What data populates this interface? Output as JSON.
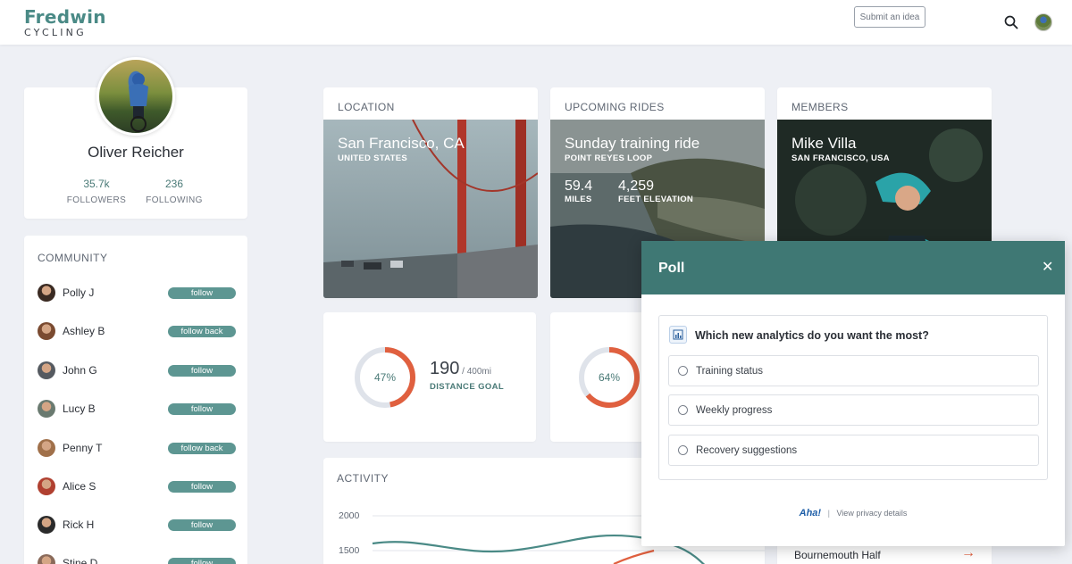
{
  "header": {
    "logo_top": "Fredwin",
    "logo_bottom": "CYCLING",
    "submit_label": "Submit an idea"
  },
  "profile": {
    "name": "Oliver Reicher",
    "followers_count": "35.7k",
    "followers_label": "FOLLOWERS",
    "following_count": "236",
    "following_label": "FOLLOWING"
  },
  "community": {
    "title": "COMMUNITY",
    "members": [
      {
        "name": "Polly J",
        "action": "follow",
        "color": "#3a2a22"
      },
      {
        "name": "Ashley B",
        "action": "follow back",
        "color": "#7a4a30"
      },
      {
        "name": "John G",
        "action": "follow",
        "color": "#555a60"
      },
      {
        "name": "Lucy B",
        "action": "follow",
        "color": "#6a7a70"
      },
      {
        "name": "Penny T",
        "action": "follow back",
        "color": "#a0704a"
      },
      {
        "name": "Alice S",
        "action": "follow",
        "color": "#b04030"
      },
      {
        "name": "Rick H",
        "action": "follow",
        "color": "#2a2a2a"
      },
      {
        "name": "Stine D",
        "action": "follow",
        "color": "#8a6a5a"
      }
    ]
  },
  "location": {
    "label": "LOCATION",
    "title": "San Francisco, CA",
    "subtitle": "UNITED STATES"
  },
  "rides": {
    "label": "UPCOMING RIDES",
    "title": "Sunday training ride",
    "subtitle": "POINT REYES LOOP",
    "miles": "59.4",
    "miles_label": "MILES",
    "elevation": "4,259",
    "elevation_label": "FEET ELEVATION"
  },
  "members": {
    "label": "MEMBERS",
    "title": "Mike Villa",
    "subtitle": "SAN FRANCISCO, USA"
  },
  "goals": [
    {
      "percent_text": "47%",
      "fraction": 0.47,
      "value": "190",
      "of": " / 400mi",
      "label": "DISTANCE GOAL"
    },
    {
      "percent_text": "64%",
      "fraction": 0.64
    }
  ],
  "activity": {
    "label": "ACTIVITY",
    "y_ticks": [
      "2000",
      "1500"
    ]
  },
  "race": {
    "name": "Bournemouth Half",
    "arrow": "→"
  },
  "poll": {
    "title": "Poll",
    "close": "✕",
    "question": "Which new analytics do you want the most?",
    "options": [
      "Training status",
      "Weekly progress",
      "Recovery suggestions"
    ],
    "brand": "Aha!",
    "divider": "|",
    "privacy": "View privacy details"
  },
  "colors": {
    "accent": "#4a8a86",
    "poll_header": "#3f7874",
    "ring": "#e0603f",
    "ring_track": "#dfe3ea"
  }
}
